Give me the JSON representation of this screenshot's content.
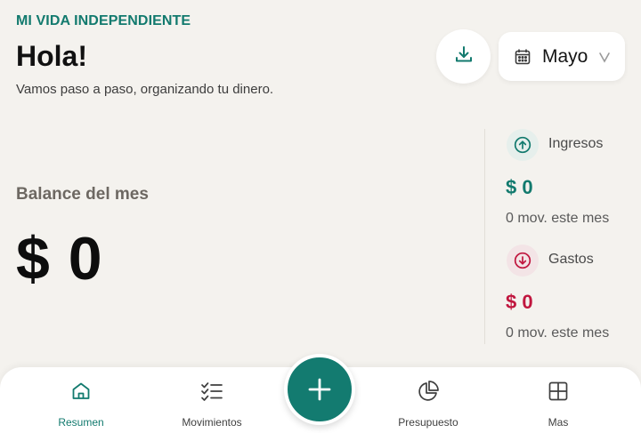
{
  "header": {
    "brand": "MI VIDA INDEPENDIENTE",
    "greeting": "Hola!",
    "subtitle": "Vamos paso a paso, organizando tu dinero.",
    "month": "Mayo"
  },
  "balance": {
    "label": "Balance del mes",
    "value": "$ 0"
  },
  "income": {
    "label": "Ingresos",
    "value": "$ 0",
    "note": "0 mov. este mes"
  },
  "expenses": {
    "label": "Gastos",
    "value": "$ 0",
    "note": "0 mov. este mes"
  },
  "nav": {
    "items": [
      {
        "label": "Resumen",
        "icon": "home-icon",
        "active": true
      },
      {
        "label": "Movimientos",
        "icon": "checklist-icon",
        "active": false
      },
      {
        "label": "Presupuesto",
        "icon": "pie-chart-icon",
        "active": false
      },
      {
        "label": "Mas",
        "icon": "grid-icon",
        "active": false
      }
    ],
    "fab_icon": "plus-icon"
  },
  "colors": {
    "accent": "#127a6e",
    "expense": "#c0163e",
    "background": "#f4f2ee"
  }
}
